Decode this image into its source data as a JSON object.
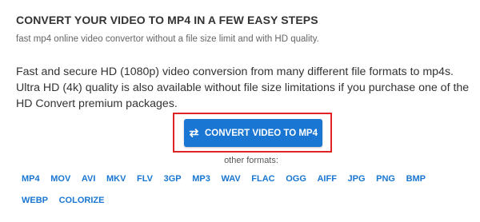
{
  "heading": "CONVERT YOUR VIDEO TO MP4 IN A FEW EASY STEPS",
  "subheading": "fast mp4 online video convertor without a file size limit and with HD quality.",
  "description": "Fast and secure HD (1080p) video conversion from many different file formats to mp4s. Ultra HD (4k) quality is also available without file size limitations if you purchase one of the HD Convert premium packages.",
  "cta": {
    "label": "CONVERT VIDEO TO MP4",
    "icon": "swap-arrows-icon",
    "background": "#1976d2",
    "highlight_color": "#e02424"
  },
  "other_formats_label": "other formats:",
  "formats": [
    "MP4",
    "MOV",
    "AVI",
    "MKV",
    "FLV",
    "3GP",
    "MP3",
    "WAV",
    "FLAC",
    "OGG",
    "AIFF",
    "JPG",
    "PNG",
    "BMP",
    "WEBP",
    "COLORIZE"
  ],
  "colors": {
    "link": "#1976d2",
    "text": "#333333"
  }
}
